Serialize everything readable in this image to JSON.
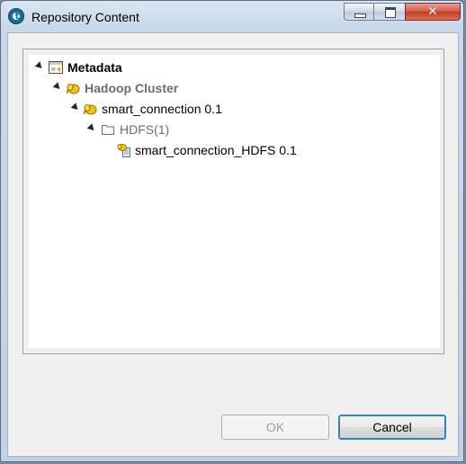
{
  "window": {
    "title": "Repository Content",
    "app_icon": "talend-logo-icon",
    "controls": {
      "minimize": "minimize-icon",
      "maximize": "maximize-icon",
      "close_glyph": "✕"
    }
  },
  "tree": {
    "root": {
      "label": "Metadata",
      "icon": "metadata-icon",
      "expanded": true
    },
    "cluster": {
      "label": "Hadoop Cluster",
      "icon": "hadoop-elephant-icon",
      "expanded": true
    },
    "connection": {
      "label": "smart_connection 0.1",
      "icon": "hadoop-elephant-icon",
      "expanded": true
    },
    "folder": {
      "label": "HDFS(1)",
      "icon": "folder-icon",
      "expanded": true
    },
    "item": {
      "label": "smart_connection_HDFS 0.1",
      "icon": "hdfs-file-icon"
    }
  },
  "buttons": {
    "ok": "OK",
    "cancel": "Cancel"
  },
  "colors": {
    "titlebar": "#c9d7ea",
    "close_button": "#c23b24",
    "dialog_background": "#f0f0f0",
    "hadoop_yellow": "#f2c21b"
  }
}
